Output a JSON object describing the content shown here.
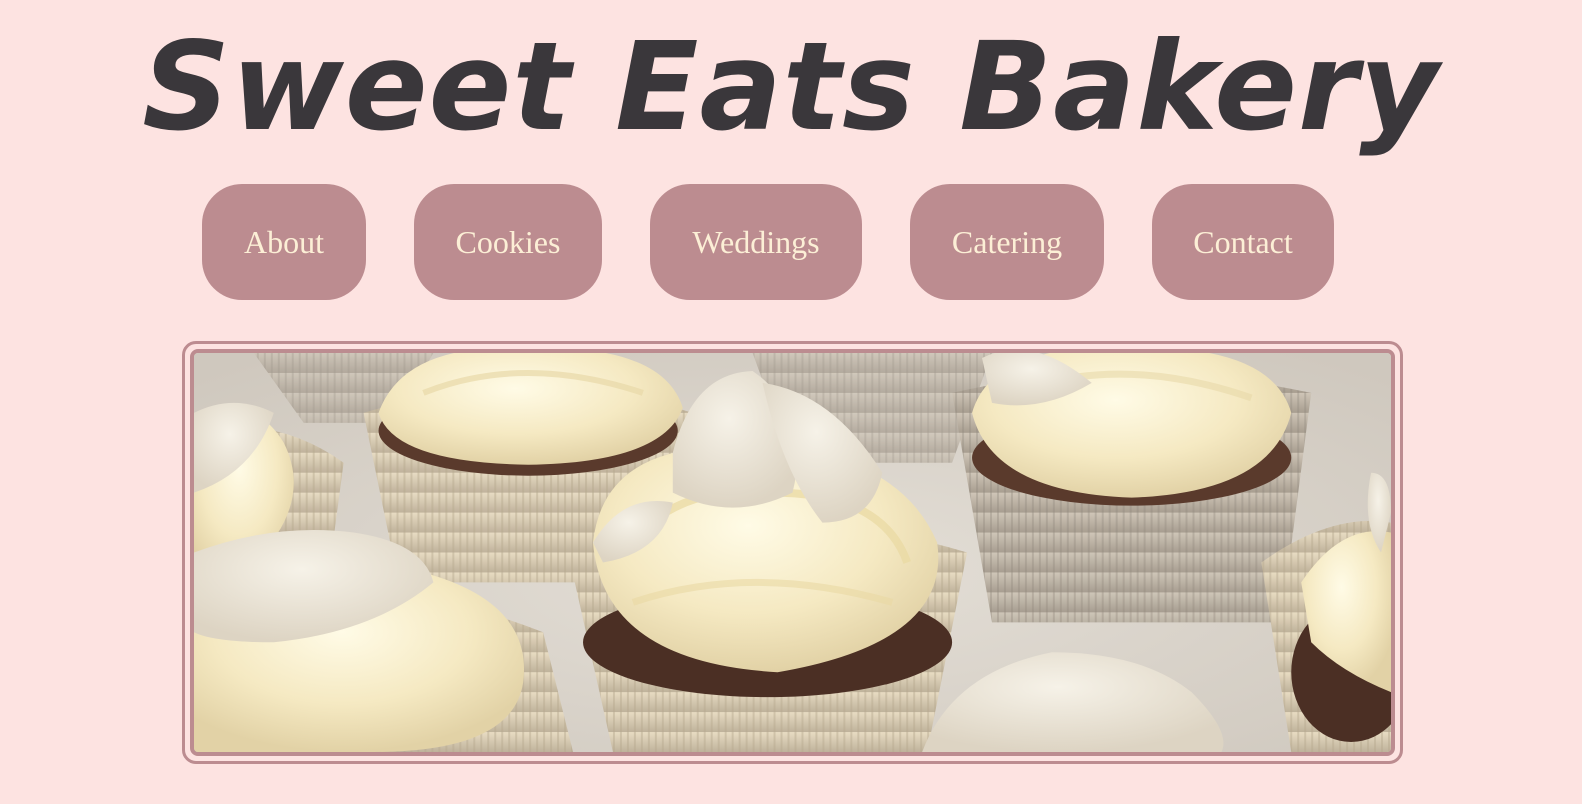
{
  "header": {
    "title": "Sweet Eats Bakery"
  },
  "nav": {
    "items": [
      {
        "label": "About"
      },
      {
        "label": "Cookies"
      },
      {
        "label": "Weddings"
      },
      {
        "label": "Catering"
      },
      {
        "label": "Contact"
      }
    ]
  },
  "hero": {
    "image": "cupcakes-photo"
  },
  "colors": {
    "background": "#fde3e1",
    "title": "#3a373b",
    "button": "#bc8c90",
    "button_text": "#fcefd6",
    "frame_border": "#bc8c90"
  }
}
